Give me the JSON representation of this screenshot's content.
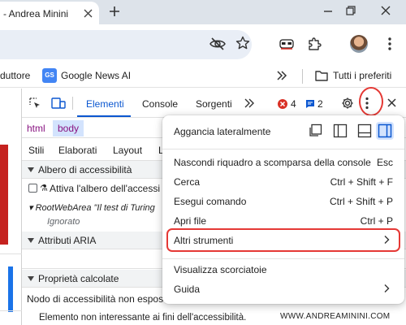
{
  "tab": {
    "title": "- Andrea Minini"
  },
  "bookmarks": {
    "item1": "duttore",
    "item2": "Google News AI",
    "item2_icon": "GS",
    "folder": "Tutti i preferiti"
  },
  "devtools": {
    "tabs": {
      "elements": "Elementi",
      "console": "Console",
      "sources": "Sorgenti"
    },
    "errors": "4",
    "messages": "2",
    "breadcrumbs": {
      "html": "html",
      "body": "body"
    },
    "subtabs": {
      "styles": "Stili",
      "computed": "Elaborati",
      "layout": "Layout",
      "more": "L"
    },
    "accessibility": {
      "tree_header": "Albero di accessibilità",
      "enable_label": "Attiva l'albero dell'accessi",
      "root_role": "RootWebArea",
      "root_name": "\"Il test di Turing",
      "ignored": "Ignorato",
      "aria_header": "Attributi ARIA",
      "computed_header": "Proprietà calcolate",
      "computed_line1": "Nodo di accessibilità non espos",
      "computed_line2": "Elemento non interessante ai fini dell'accessibilità."
    }
  },
  "menu": {
    "dock_label": "Aggancia lateralmente",
    "dock_selected": "right",
    "items": [
      {
        "label": "Nascondi riquadro a scomparsa della console",
        "shortcut": "Esc"
      },
      {
        "label": "Cerca",
        "shortcut": "Ctrl + Shift + F"
      },
      {
        "label": "Esegui comando",
        "shortcut": "Ctrl + Shift + P"
      },
      {
        "label": "Apri file",
        "shortcut": "Ctrl + P"
      },
      {
        "label": "Altri strumenti",
        "submenu": true,
        "highlighted": true
      },
      {
        "label": "Visualizza scorciatoie"
      },
      {
        "label": "Guida",
        "submenu": true
      }
    ]
  },
  "watermark": "WWW.ANDREAMININI.COM",
  "colors": {
    "accent": "#0b57d0",
    "highlight": "#e53935",
    "error": "#d93025",
    "crumb_selected": "#d3e3fd"
  }
}
